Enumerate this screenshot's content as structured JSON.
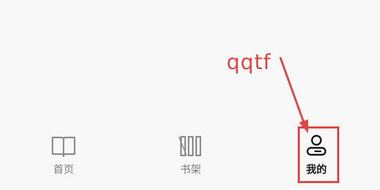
{
  "annotation": {
    "text": "qqtf",
    "color": "#e24343"
  },
  "tabbar": {
    "tabs": [
      {
        "label": "首页",
        "icon": "book-open-icon",
        "active": false
      },
      {
        "label": "书架",
        "icon": "bookshelf-icon",
        "active": false
      },
      {
        "label": "我的",
        "icon": "user-profile-icon",
        "active": true
      }
    ]
  }
}
